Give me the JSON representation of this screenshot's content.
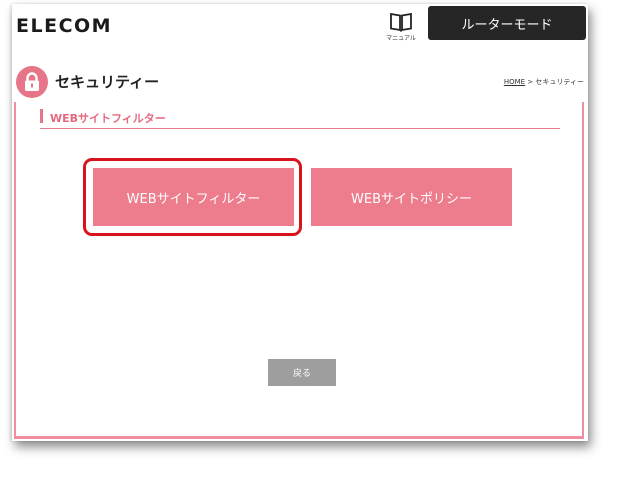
{
  "header": {
    "logo": "ELECOM",
    "manual_label": "マニュアル",
    "mode_tab": "ルーターモード"
  },
  "page": {
    "title": "セキュリティー",
    "breadcrumb_home": "HOME",
    "breadcrumb_sep": " > ",
    "breadcrumb_current": "セキュリティー"
  },
  "section": {
    "title": "WEBサイトフィルター"
  },
  "buttons": {
    "filter": "WEBサイトフィルター",
    "policy": "WEBサイトポリシー",
    "back": "戻る"
  },
  "colors": {
    "accent_pink": "#ed7c8d",
    "highlight_red": "#d7141c",
    "mode_tab_bg": "#262626",
    "back_button_bg": "#9e9e9e"
  },
  "icons": {
    "manual": "book-icon",
    "section": "lock-icon"
  }
}
